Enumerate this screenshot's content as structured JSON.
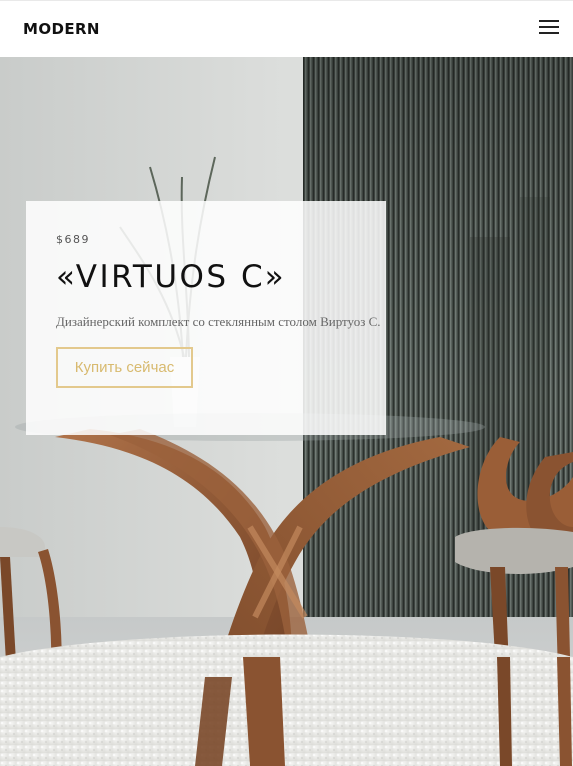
{
  "header": {
    "logo": "MODERN",
    "menu_icon": "hamburger-menu-icon"
  },
  "hero": {
    "image": "designer-glass-dining-table-with-chairs"
  },
  "promo": {
    "price": "$689",
    "title": "«VIRTUOS C»",
    "description": "Дизайнерский комплект со стеклянным столом Виртуоз С.",
    "button_label": "Купить сейчас"
  },
  "colors": {
    "button_border": "#e3c98d",
    "button_text": "#d8ba6f",
    "header_bg": "#ffffff"
  }
}
